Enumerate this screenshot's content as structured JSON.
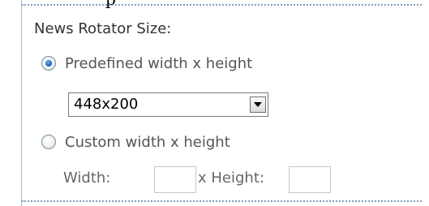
{
  "header_fragment": "p",
  "section": {
    "label": "News Rotator Size:"
  },
  "size_options": {
    "predefined": {
      "label": "Predefined width x height",
      "selected": true
    },
    "custom": {
      "label": "Custom width x height",
      "selected": false
    }
  },
  "predefined_select": {
    "value": "448x200"
  },
  "custom_fields": {
    "width_label": "Width:",
    "width_value": "",
    "height_label": "x Height:",
    "height_value": ""
  },
  "colors": {
    "label_text": "#333333",
    "option_text": "#555555",
    "dotted_separator": "#7f9cc0",
    "radio_checked": "#1d5fb8"
  },
  "icons": {
    "dropdown": "chevron-down-icon"
  }
}
